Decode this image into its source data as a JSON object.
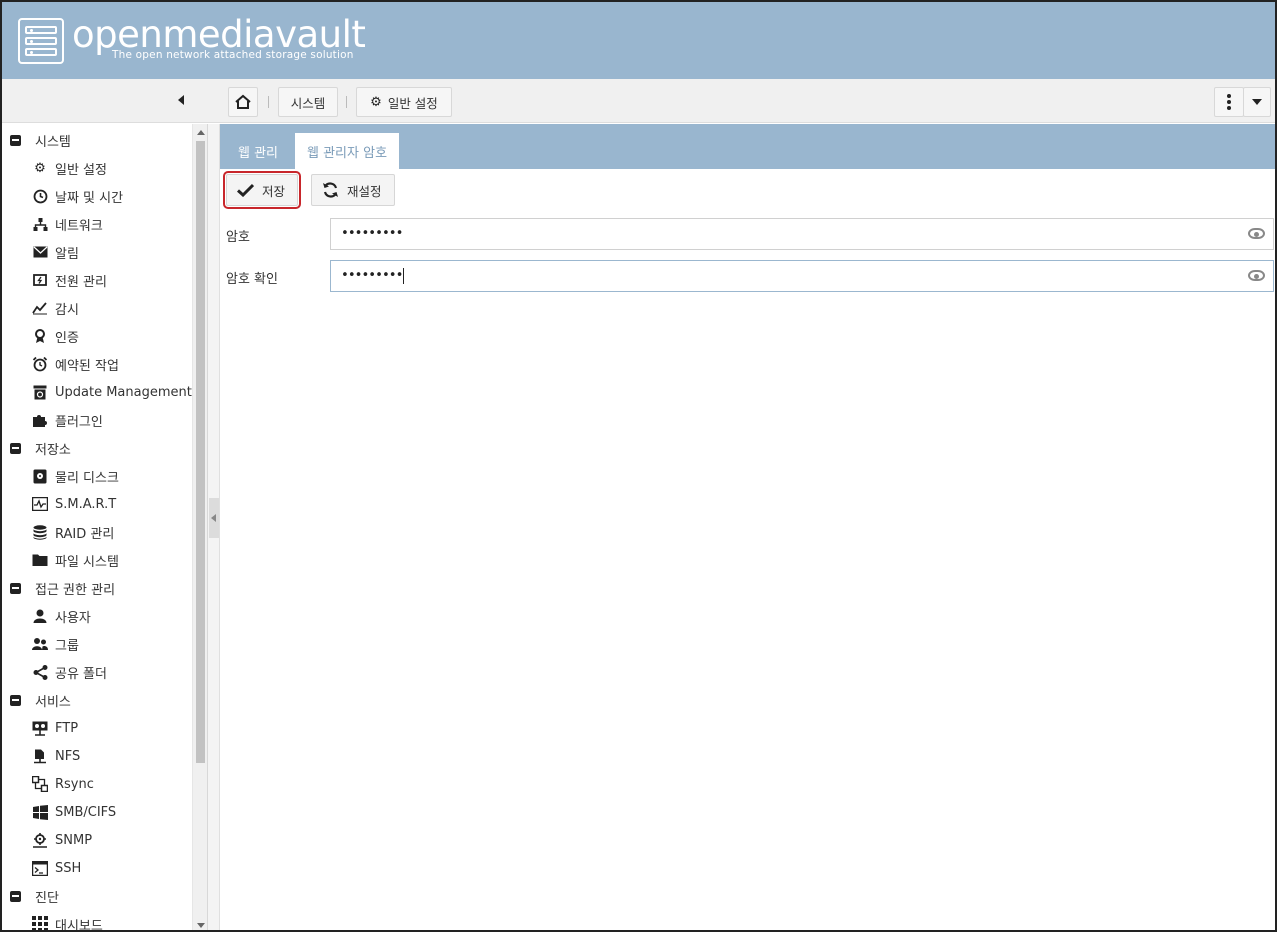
{
  "header": {
    "logo_title": "openmediavault",
    "logo_subtitle": "The open network attached storage solution"
  },
  "toolbar": {
    "breadcrumb_home_icon": "home-icon",
    "breadcrumb_system": "시스템",
    "breadcrumb_general": "일반 설정",
    "more_icon": "vertical-dots-icon",
    "dropdown_icon": "caret-down-icon"
  },
  "nav": {
    "groups": [
      {
        "label": "시스템",
        "items": [
          {
            "label": "일반 설정",
            "icon": "gears-icon"
          },
          {
            "label": "날짜 및 시간",
            "icon": "clock-icon"
          },
          {
            "label": "네트워크",
            "icon": "network-icon"
          },
          {
            "label": "알림",
            "icon": "envelope-icon"
          },
          {
            "label": "전원 관리",
            "icon": "power-icon"
          },
          {
            "label": "감시",
            "icon": "chart-line-icon"
          },
          {
            "label": "인증",
            "icon": "certificate-icon"
          },
          {
            "label": "예약된 작업",
            "icon": "alarm-clock-icon"
          },
          {
            "label": "Update Management",
            "icon": "update-icon"
          },
          {
            "label": "플러그인",
            "icon": "puzzle-icon"
          }
        ]
      },
      {
        "label": "저장소",
        "items": [
          {
            "label": "물리 디스크",
            "icon": "hdd-icon"
          },
          {
            "label": "S.M.A.R.T",
            "icon": "pulse-icon"
          },
          {
            "label": "RAID 관리",
            "icon": "database-icon"
          },
          {
            "label": "파일 시스템",
            "icon": "folder-icon"
          }
        ]
      },
      {
        "label": "접근 권한 관리",
        "items": [
          {
            "label": "사용자",
            "icon": "user-icon"
          },
          {
            "label": "그룹",
            "icon": "users-icon"
          },
          {
            "label": "공유 폴더",
            "icon": "share-icon"
          }
        ]
      },
      {
        "label": "서비스",
        "items": [
          {
            "label": "FTP",
            "icon": "ftp-icon"
          },
          {
            "label": "NFS",
            "icon": "nfs-icon"
          },
          {
            "label": "Rsync",
            "icon": "rsync-icon"
          },
          {
            "label": "SMB/CIFS",
            "icon": "windows-icon"
          },
          {
            "label": "SNMP",
            "icon": "snmp-icon"
          },
          {
            "label": "SSH",
            "icon": "terminal-icon"
          }
        ]
      },
      {
        "label": "진단",
        "items": [
          {
            "label": "대시보드",
            "icon": "grid-icon"
          }
        ]
      }
    ]
  },
  "tabs": [
    {
      "label": "웹 관리",
      "active": false
    },
    {
      "label": "웹 관리자 암호",
      "active": true
    }
  ],
  "actions": {
    "save": "저장",
    "reset": "재설정"
  },
  "form": {
    "password_label": "암호",
    "password_value": "•••••••••",
    "confirm_label": "암호 확인",
    "confirm_value": "•••••••••"
  },
  "colors": {
    "header_bg": "#99b6cf",
    "highlight_border": "#c8262b"
  }
}
